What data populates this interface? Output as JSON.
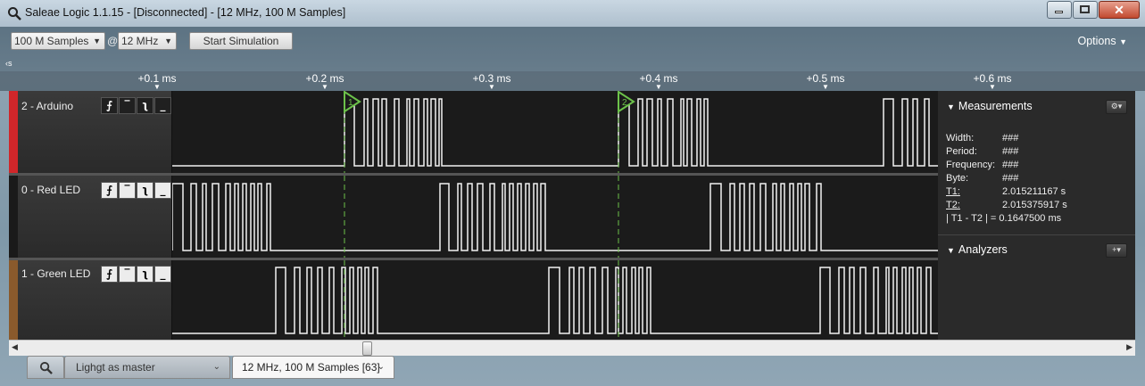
{
  "window": {
    "title": "Saleae Logic 1.1.15 - [Disconnected] - [12 MHz, 100 M Samples]",
    "close_glyph": "✕"
  },
  "toolbar": {
    "samples_value": "100 M Samples",
    "at_symbol": "@",
    "rate_value": "12 MHz",
    "start_label": "Start Simulation",
    "options_label": "Options",
    "left_edge_label": "‹s"
  },
  "ruler": {
    "ticks": [
      "+0.1 ms",
      "+0.2 ms",
      "+0.3 ms",
      "+0.4 ms",
      "+0.5 ms",
      "+0.6 ms"
    ]
  },
  "channels": [
    {
      "name": "2 - Arduino",
      "color": "#d0262a"
    },
    {
      "name": "0 - Red LED",
      "color": "#1a1a1a"
    },
    {
      "name": "1 - Green LED",
      "color": "#8a5a2c"
    }
  ],
  "markers": {
    "t1_label": "1",
    "t2_label": "2",
    "color": "#6cc24a"
  },
  "measurements": {
    "title": "Measurements",
    "width_label": "Width:",
    "width_value": "###",
    "period_label": "Period:",
    "period_value": "###",
    "frequency_label": "Frequency:",
    "frequency_value": "###",
    "byte_label": "Byte:",
    "byte_value": "###",
    "t1_label": "T1:",
    "t1_value": "2.015211167 s",
    "t2_label": "T2:",
    "t2_value": "2.015375917 s",
    "diff_text": "| T1 - T2 | = 0.1647500 ms"
  },
  "analyzers": {
    "title": "Analyzers"
  },
  "tabs": {
    "tab1_label": "Lighgt as master",
    "tab2_label": "12 MHz, 100 M Samples [63]"
  }
}
